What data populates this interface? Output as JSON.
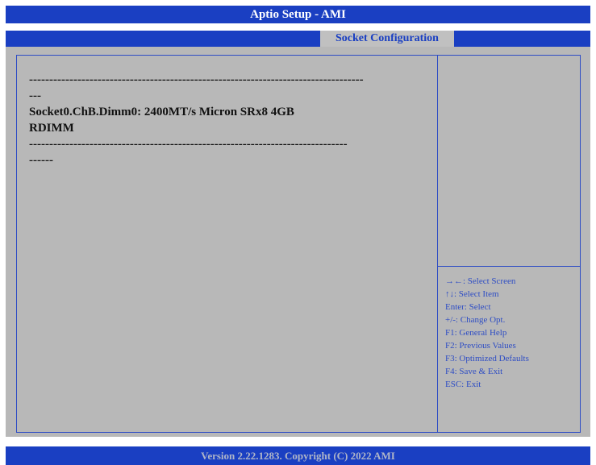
{
  "header": {
    "title": "Aptio Setup - AMI"
  },
  "tabs": {
    "active": "Socket Configuration"
  },
  "main": {
    "lines": [
      "-----------------------------------------------------------------------------------",
      "---",
      "Socket0.ChB.Dimm0: 2400MT/s Micron SRx8 4GB",
      "RDIMM",
      "-------------------------------------------------------------------------------",
      "------"
    ]
  },
  "help": {
    "items": [
      "→←: Select Screen",
      "↑↓: Select Item",
      "Enter: Select",
      "+/-: Change Opt.",
      "F1: General Help",
      "F2: Previous Values",
      "F3: Optimized Defaults",
      "F4: Save & Exit",
      "ESC: Exit"
    ]
  },
  "footer": {
    "text": "Version 2.22.1283. Copyright (C) 2022 AMI"
  },
  "colors": {
    "bar_blue": "#1a3fc2",
    "panel_gray": "#b8b8b8",
    "frame_blue": "#2e4dc4",
    "text_dark": "#111111"
  }
}
